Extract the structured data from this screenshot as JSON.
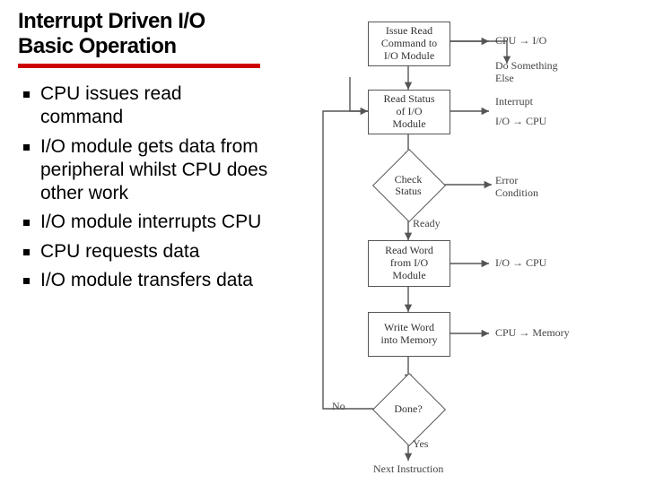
{
  "title_line1": "Interrupt Driven I/O",
  "title_line2": "Basic Operation",
  "bullets": [
    "CPU issues read command",
    "I/O module gets data from peripheral whilst CPU does other work",
    "I/O module interrupts CPU",
    "CPU requests data",
    "I/O module transfers data"
  ],
  "diagram": {
    "boxes": {
      "issue": "Issue Read\nCommand to\nI/O Module",
      "readstatus": "Read Status\nof I/O\nModule",
      "readword": "Read Word\nfrom I/O\nModule",
      "writeword": "Write Word\ninto Memory"
    },
    "diamonds": {
      "check": "Check\nStatus",
      "done": "Done?"
    },
    "edge_labels": {
      "ready": "Ready",
      "yes": "Yes",
      "no": "No",
      "next": "Next Instruction"
    },
    "annotations": {
      "issue_right": "CPU → I/O",
      "dosomething": "Do Something\nElse",
      "interrupt": "Interrupt",
      "readstatus_right": "I/O → CPU",
      "error": "Error\nCondition",
      "readword_right": "I/O → CPU",
      "writeword_right": "CPU → Memory"
    }
  }
}
